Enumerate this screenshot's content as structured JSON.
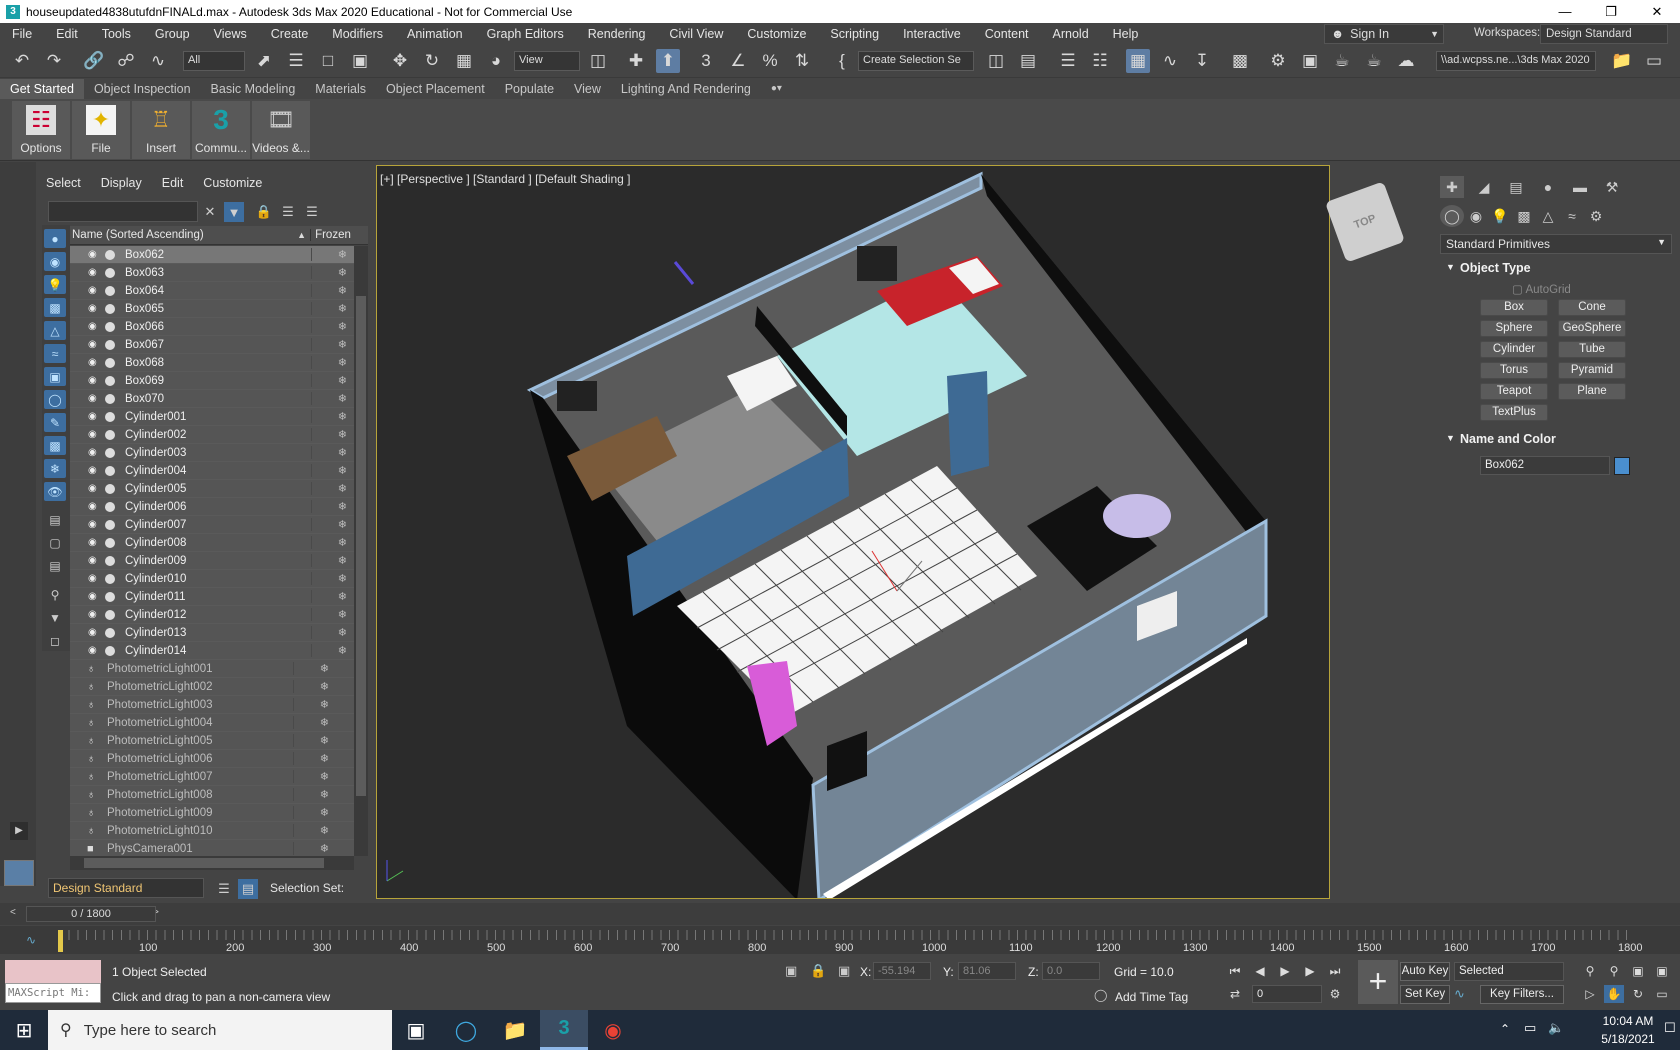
{
  "window": {
    "title": "houseupdated4838utufdnFINALd.max - Autodesk 3ds Max 2020 Educational - Not for Commercial Use",
    "minimize": "—",
    "maximize": "❐",
    "close": "✕"
  },
  "menu": [
    "File",
    "Edit",
    "Tools",
    "Group",
    "Views",
    "Create",
    "Modifiers",
    "Animation",
    "Graph Editors",
    "Rendering",
    "Civil View",
    "Customize",
    "Scripting",
    "Interactive",
    "Content",
    "Arnold",
    "Help"
  ],
  "signin": "Sign In",
  "workspaces": {
    "label": "Workspaces:",
    "value": "Design Standard"
  },
  "toolbar": {
    "filter": "All",
    "refcoord": "View",
    "selection_set": "Create Selection Se",
    "path": "\\\\ad.wcpss.ne...\\3ds Max 2020"
  },
  "ribbon_tabs": [
    "Get Started",
    "Object Inspection",
    "Basic Modeling",
    "Materials",
    "Object Placement",
    "Populate",
    "View",
    "Lighting And Rendering"
  ],
  "ribbon_buttons": [
    "Options",
    "File",
    "Insert",
    "Commu...",
    "Videos &..."
  ],
  "explorer": {
    "menu": [
      "Select",
      "Display",
      "Edit",
      "Customize"
    ],
    "col_name": "Name (Sorted Ascending)",
    "col_frozen": "Frozen",
    "rows": [
      {
        "name": "Box062",
        "type": "geo",
        "selected": true
      },
      {
        "name": "Box063",
        "type": "geo"
      },
      {
        "name": "Box064",
        "type": "geo"
      },
      {
        "name": "Box065",
        "type": "geo"
      },
      {
        "name": "Box066",
        "type": "geo"
      },
      {
        "name": "Box067",
        "type": "geo"
      },
      {
        "name": "Box068",
        "type": "geo"
      },
      {
        "name": "Box069",
        "type": "geo"
      },
      {
        "name": "Box070",
        "type": "geo"
      },
      {
        "name": "Cylinder001",
        "type": "geo"
      },
      {
        "name": "Cylinder002",
        "type": "geo"
      },
      {
        "name": "Cylinder003",
        "type": "geo"
      },
      {
        "name": "Cylinder004",
        "type": "geo"
      },
      {
        "name": "Cylinder005",
        "type": "geo"
      },
      {
        "name": "Cylinder006",
        "type": "geo"
      },
      {
        "name": "Cylinder007",
        "type": "geo"
      },
      {
        "name": "Cylinder008",
        "type": "geo"
      },
      {
        "name": "Cylinder009",
        "type": "geo"
      },
      {
        "name": "Cylinder010",
        "type": "geo"
      },
      {
        "name": "Cylinder011",
        "type": "geo"
      },
      {
        "name": "Cylinder012",
        "type": "geo"
      },
      {
        "name": "Cylinder013",
        "type": "geo"
      },
      {
        "name": "Cylinder014",
        "type": "geo"
      },
      {
        "name": "PhotometricLight001",
        "type": "light"
      },
      {
        "name": "PhotometricLight002",
        "type": "light"
      },
      {
        "name": "PhotometricLight003",
        "type": "light"
      },
      {
        "name": "PhotometricLight004",
        "type": "light"
      },
      {
        "name": "PhotometricLight005",
        "type": "light"
      },
      {
        "name": "PhotometricLight006",
        "type": "light"
      },
      {
        "name": "PhotometricLight007",
        "type": "light"
      },
      {
        "name": "PhotometricLight008",
        "type": "light"
      },
      {
        "name": "PhotometricLight009",
        "type": "light"
      },
      {
        "name": "PhotometricLight010",
        "type": "light"
      },
      {
        "name": "PhysCamera001",
        "type": "camera"
      }
    ],
    "layer": "Design Standard",
    "selection_set_label": "Selection Set:"
  },
  "viewport": {
    "label": "[+] [Perspective ] [Standard ] [Default Shading ]",
    "viewcube": "TOP"
  },
  "command_panel": {
    "dropdown": "Standard Primitives",
    "object_type": "Object Type",
    "autogrid": "AutoGrid",
    "primitives": [
      "Box",
      "Cone",
      "Sphere",
      "GeoSphere",
      "Cylinder",
      "Tube",
      "Torus",
      "Pyramid",
      "Teapot",
      "Plane",
      "TextPlus"
    ],
    "name_and_color": "Name and Color",
    "object_name": "Box062",
    "object_color": "#4a8fcf"
  },
  "timeline": {
    "frame_counter": "0 / 1800",
    "ticks": [
      "100",
      "200",
      "300",
      "400",
      "500",
      "600",
      "700",
      "800",
      "900",
      "1000",
      "1100",
      "1200",
      "1300",
      "1400",
      "1500",
      "1600",
      "1700",
      "1800"
    ]
  },
  "status": {
    "maxscript": "MAXScript Mi:",
    "selected": "1 Object Selected",
    "prompt": "Click and drag to pan a non-camera view",
    "x_label": "X:",
    "x_value": "-55.194",
    "y_label": "Y:",
    "y_value": "81.06",
    "z_label": "Z:",
    "z_value": "0.0",
    "grid": "Grid = 10.0",
    "add_time_tag": "Add Time Tag",
    "auto_key": "Auto Key",
    "set_key": "Set Key",
    "key_set": "Selected",
    "key_filters": "Key Filters...",
    "frame": "0"
  },
  "taskbar": {
    "search_placeholder": "Type here to search",
    "time": "10:04 AM",
    "date": "5/18/2021"
  }
}
